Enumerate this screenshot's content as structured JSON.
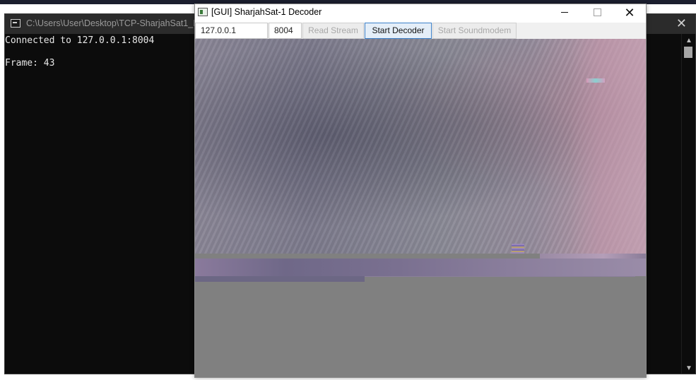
{
  "console": {
    "title": "C:\\Users\\User\\Desktop\\TCP-SharjahSat1_Imag",
    "lines": [
      "Connected to 127.0.0.1:8004",
      "",
      "Frame: 43"
    ],
    "close_glyph": "✕"
  },
  "gui": {
    "title": "[GUI] SharjahSat-1 Decoder",
    "controls": {
      "close_glyph": "✕"
    },
    "toolbar": {
      "ip_value": "127.0.0.1",
      "port_value": "8004",
      "read_stream_label": "Read Stream",
      "start_decoder_label": "Start Decoder",
      "start_soundmodem_label": "Start Soundmodem"
    }
  },
  "colors": {
    "console_bg": "#0c0c0c",
    "console_text": "#e6e6e6",
    "active_button_border": "#3c80c8",
    "disabled_text": "#a8a8a8",
    "image_gray_fill": "#808080"
  },
  "icons": [
    "console-app-icon",
    "gui-app-icon",
    "minimize-icon",
    "maximize-icon",
    "close-icon",
    "scroll-up-icon",
    "scroll-down-icon"
  ]
}
